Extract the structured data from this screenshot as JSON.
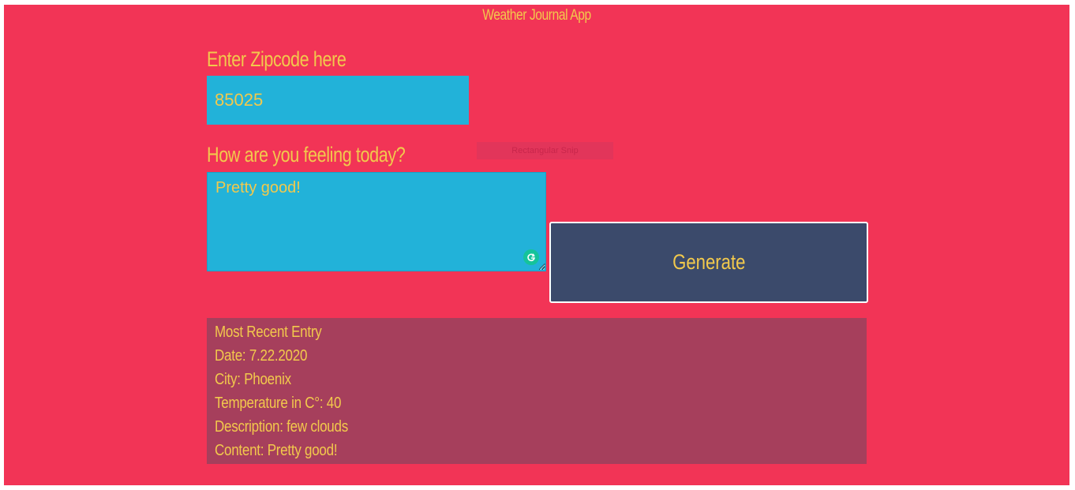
{
  "app": {
    "title": "Weather Journal App",
    "background_color": "#f23456",
    "text_color": "#f2c94c"
  },
  "zip": {
    "label": "Enter Zipcode here",
    "value": "85025"
  },
  "feelings": {
    "label": "How are you feeling today?",
    "value": "Pretty good!"
  },
  "overlay": {
    "snip_tooltip": "Rectangular Snip"
  },
  "generate": {
    "label": "Generate",
    "color": "#3b4a6b"
  },
  "entry": {
    "heading": "Most Recent Entry",
    "date": "Date: 7.22.2020",
    "city": "City: Phoenix",
    "temperature": "Temperature in C°: 40",
    "description": "Description: few clouds",
    "content": "Content: Pretty good!"
  },
  "icons": {
    "grammarly": "grammarly-icon",
    "resize": "resize-grip-icon"
  }
}
